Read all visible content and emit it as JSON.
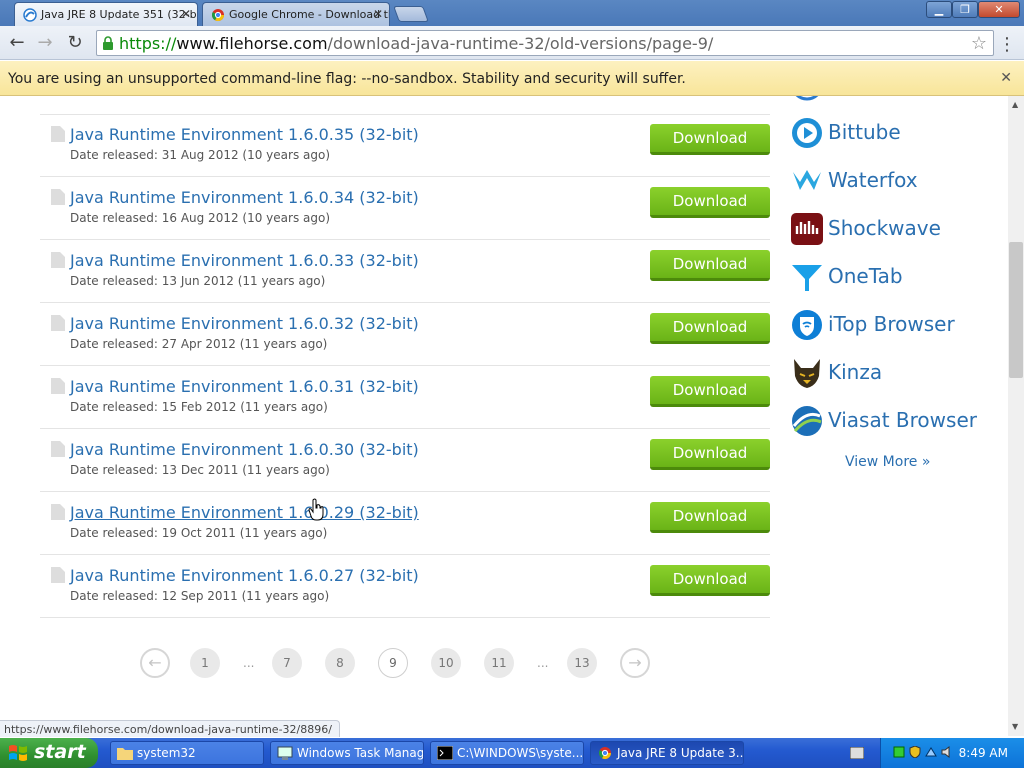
{
  "browser": {
    "tabs": [
      {
        "title": "Java JRE 8 Update 351 (32-b",
        "active": true
      },
      {
        "title": "Google Chrome - Download th",
        "active": false
      }
    ],
    "url": {
      "scheme": "https://",
      "host": "www.filehorse.com",
      "path": "/download-java-runtime-32/old-versions/page-9/"
    },
    "infobar_message": "You are using an unsupported command-line flag: --no-sandbox. Stability and security will suffer.",
    "status_url": "https://www.filehorse.com/download-java-runtime-32/8896/"
  },
  "versions": [
    {
      "name": "Java Runtime Environment 1.6.0.35 (32-bit)",
      "date": "Date released: 31 Aug 2012 (10 years ago)"
    },
    {
      "name": "Java Runtime Environment 1.6.0.34 (32-bit)",
      "date": "Date released: 16 Aug 2012 (10 years ago)"
    },
    {
      "name": "Java Runtime Environment 1.6.0.33 (32-bit)",
      "date": "Date released: 13 Jun 2012 (11 years ago)"
    },
    {
      "name": "Java Runtime Environment 1.6.0.32 (32-bit)",
      "date": "Date released: 27 Apr 2012 (11 years ago)"
    },
    {
      "name": "Java Runtime Environment 1.6.0.31 (32-bit)",
      "date": "Date released: 15 Feb 2012 (11 years ago)"
    },
    {
      "name": "Java Runtime Environment 1.6.0.30 (32-bit)",
      "date": "Date released: 13 Dec 2011 (11 years ago)"
    },
    {
      "name": "Java Runtime Environment 1.6.0.29 (32-bit)",
      "date": "Date released: 19 Oct 2011 (11 years ago)"
    },
    {
      "name": "Java Runtime Environment 1.6.0.27 (32-bit)",
      "date": "Date released: 12 Sep 2011 (11 years ago)"
    }
  ],
  "download_label": "Download",
  "pagination": {
    "prev": "←",
    "pages": [
      "1",
      "7",
      "8",
      "9",
      "10",
      "11",
      "13"
    ],
    "current": "9",
    "ellipsis": "...",
    "next": "→"
  },
  "sidebar": {
    "apps": [
      {
        "name": "Bittube",
        "color": "#1e8fd6"
      },
      {
        "name": "Waterfox",
        "color": "#2aa7e0"
      },
      {
        "name": "Shockwave",
        "color": "#7a1014"
      },
      {
        "name": "OneTab",
        "color": "#1aa0e8"
      },
      {
        "name": "iTop Browser",
        "color": "#0e7fd6"
      },
      {
        "name": "Kinza",
        "color": "#5a4a2a"
      },
      {
        "name": "Viasat Browser",
        "color": "#1c6fb8"
      }
    ],
    "view_more": "View More »"
  },
  "taskbar": {
    "start_label": "start",
    "tasks": [
      {
        "label": "system32",
        "active": false
      },
      {
        "label": "Windows Task Manager",
        "active": false
      },
      {
        "label": "C:\\WINDOWS\\syste...",
        "active": false
      },
      {
        "label": "Java JRE 8 Update 3...",
        "active": true
      }
    ],
    "clock": "8:49 AM"
  },
  "colors": {
    "link": "#2a6fb0",
    "download_green": "#6ab317",
    "infobar": "#f8e59a"
  }
}
